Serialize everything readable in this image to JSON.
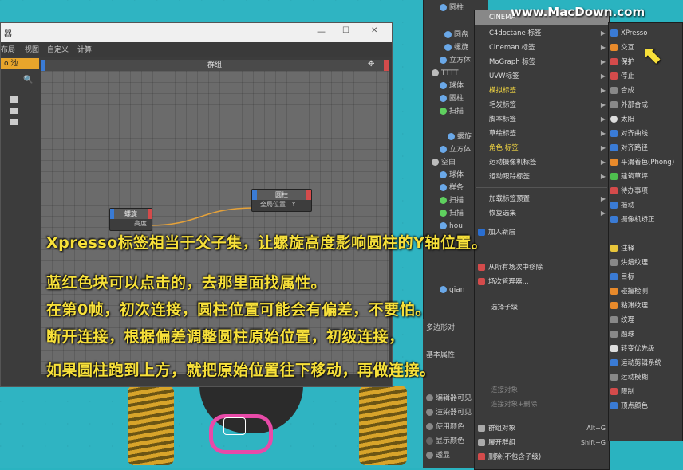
{
  "watermark": "www.MacDown.com",
  "window": {
    "title": "器",
    "controls": [
      "—",
      "☐",
      "✕"
    ],
    "menus": [
      "布局",
      "视图",
      "自定义",
      "计算"
    ],
    "canvas_title": "群组",
    "left_label": "o 池"
  },
  "nodes": {
    "helix": {
      "title": "螺旋",
      "port": "高度"
    },
    "cylinder": {
      "title": "圆柱",
      "port": "全局位置 . Y"
    }
  },
  "object_panel": {
    "items": [
      "圆柱",
      "圆盘",
      "螺旋",
      "立方体",
      "TTTT",
      "球体",
      "圆柱",
      "扫描",
      "螺旋",
      "立方体",
      "空白",
      "球体",
      "样条",
      "扫描",
      "扫描",
      "hou",
      "qian",
      "多边形对",
      "基本属性",
      "编辑器可见",
      "渲染器可见",
      "使用颜色",
      "显示颜色",
      "透显"
    ]
  },
  "tag_menu": {
    "header": "CINEMA",
    "items": [
      "C4doctane 标签",
      "Cineman 标签",
      "MoGraph 标签",
      "UVW标签",
      "模拟标签",
      "毛发标签",
      "脚本标签",
      "草绘标签",
      "角色 标签",
      "运动摄像机标签",
      "运动跟踪标签",
      "加载标签预置",
      "恢复选集",
      "加入新层",
      "从所有场次中移除",
      "场次管理器...",
      "选择子级",
      "选择子级",
      "连接对象",
      "连接对象+删除",
      "群组对象",
      "展开群组",
      "删除(不包含子级)"
    ],
    "shortcuts": {
      "group": "Alt+G",
      "expand": "Shift+G"
    }
  },
  "sub_menu": {
    "items": [
      "XPresso",
      "交互",
      "保护",
      "停止",
      "合成",
      "外部合成",
      "太阳",
      "对齐曲线",
      "对齐路径",
      "平滑着色(Phong)",
      "建筑草坪",
      "待办事项",
      "振动",
      "摄像机矫正",
      "注释",
      "烘焙纹理",
      "目标",
      "碰撞检测",
      "粘滞纹理",
      "纹理",
      "融球",
      "转变优先级",
      "运动剪辑系统",
      "运动模糊",
      "限制",
      "顶点颜色"
    ]
  },
  "overlay": [
    "Xpresso标签相当于父子集，让螺旋高度影响圆柱的Y轴位置。",
    "蓝红色块可以点击的，去那里面找属性。",
    "在第0帧，初次连接，圆柱位置可能会有偏差，不要怕。",
    "断开连接，根据偏差调整圆柱原始位置，初级连接，",
    "如果圆柱跑到上方，就把原始位置往下移动，再做连接。"
  ]
}
